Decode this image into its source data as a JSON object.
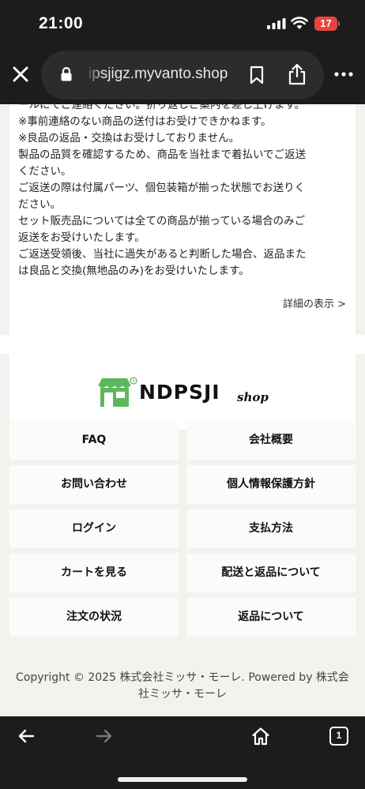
{
  "status_bar": {
    "time": "21:00",
    "battery_level": "17",
    "battery_color": "#e5453b"
  },
  "browser": {
    "url": "ipsjigz.myvanto.shop",
    "icons": [
      "close-icon",
      "lock-icon",
      "bookmark-icon",
      "share-icon",
      "more-icon"
    ]
  },
  "policy": {
    "lines": [
      "ールにてご連絡ください。折り返しご案内を差し上げます。",
      "※事前連絡のない商品の送付はお受けできかねます。",
      "※良品の返品・交換はお受けしておりません。",
      "製品の品質を確認するため、商品を当社まで着払いでご返送",
      "ください。",
      "ご返送の際は付属パーツ、個包装箱が揃った状態でお送りく",
      "ださい。",
      "セット販売品については全ての商品が揃っている場合のみご",
      "返送をお受けいたします。",
      "ご返送受領後、当社に過失があると判断した場合、返品また",
      "は良品と交換(無地品のみ)をお受けいたします。"
    ],
    "details_link": "詳細の表示 >"
  },
  "footer": {
    "logo_text": "NDPSJI",
    "logo_shop": "shop",
    "brand_color": "#5cb85c",
    "links": [
      "FAQ",
      "会社概要",
      "お問い合わせ",
      "個人情報保護方針",
      "ログイン",
      "支払方法",
      "カートを見る",
      "配送と返品について",
      "注文の状況",
      "返品について"
    ],
    "copyright_line1": "Copyright © 2025 株式会社ミッサ・モーレ. Powered by 株式会",
    "copyright_line2": "社ミッサ・モーレ"
  },
  "bottom_bar": {
    "tab_count": "1",
    "icons": [
      "back-arrow-icon",
      "forward-arrow-icon",
      "home-icon",
      "tabs-icon"
    ]
  }
}
